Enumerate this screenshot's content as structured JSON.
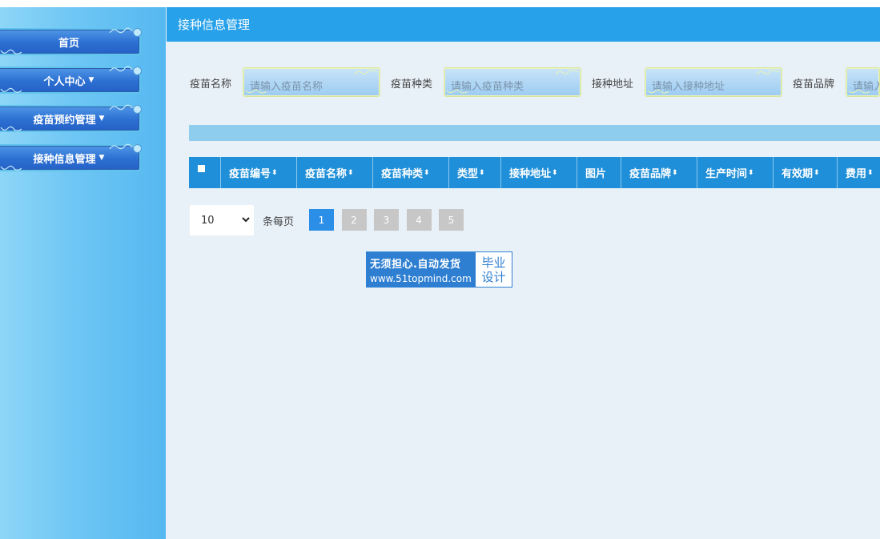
{
  "sidebar": {
    "items": [
      {
        "label": "首页",
        "has_caret": false
      },
      {
        "label": "个人中心",
        "has_caret": true
      },
      {
        "label": "疫苗预约管理",
        "has_caret": true
      },
      {
        "label": "接种信息管理",
        "has_caret": true
      }
    ]
  },
  "header": {
    "title": "接种信息管理"
  },
  "search": {
    "fields": [
      {
        "label": "疫苗名称",
        "placeholder": "请输入疫苗名称"
      },
      {
        "label": "疫苗种类",
        "placeholder": "请输入疫苗种类"
      },
      {
        "label": "接种地址",
        "placeholder": "请输入接种地址"
      },
      {
        "label": "疫苗品牌",
        "placeholder": "请输入疫苗品牌"
      }
    ]
  },
  "table": {
    "columns": [
      "疫苗编号",
      "疫苗名称",
      "疫苗种类",
      "类型",
      "接种地址",
      "图片",
      "疫苗品牌",
      "生产时间",
      "有效期",
      "费用"
    ],
    "sortable": [
      true,
      true,
      true,
      true,
      true,
      false,
      true,
      true,
      true,
      true
    ]
  },
  "pagination": {
    "page_size": "10",
    "per_page_label": "条每页",
    "pages": [
      "1",
      "2",
      "3",
      "4",
      "5"
    ],
    "active_page": "1"
  },
  "watermark": {
    "line1": "无须担心.自动发货",
    "line2": "www.51topmind.com",
    "right1": "毕业",
    "right2": "设计"
  },
  "colors": {
    "header": "#27a1e9",
    "table_header": "#1e8fd8",
    "active_page": "#2b8fe8",
    "inactive_page": "#c7c7c7"
  }
}
